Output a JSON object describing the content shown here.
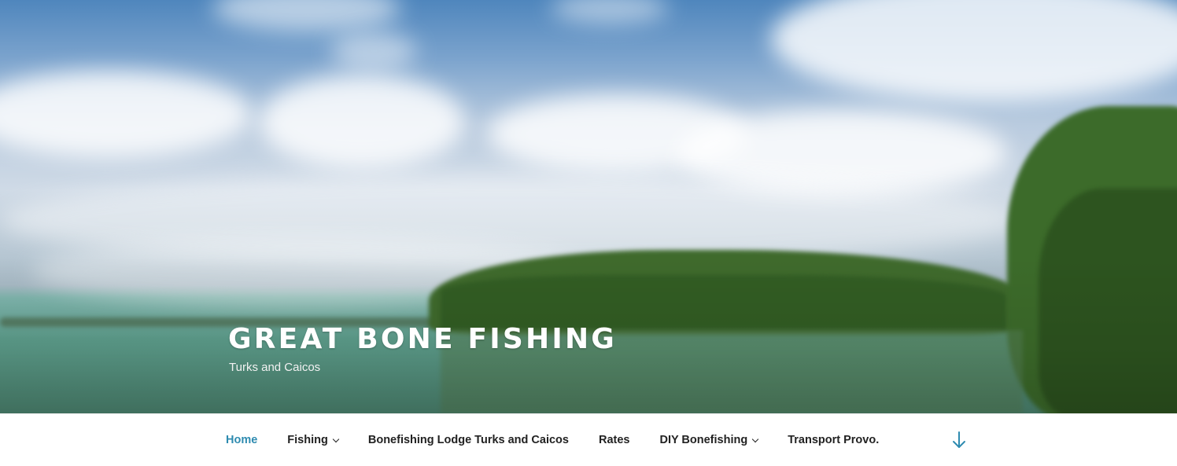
{
  "site": {
    "title": "GREAT BONE FISHING",
    "description": "Turks and Caicos"
  },
  "nav": {
    "items": [
      {
        "label": "Home",
        "current": true,
        "has_submenu": false
      },
      {
        "label": "Fishing",
        "current": false,
        "has_submenu": true
      },
      {
        "label": "Bonefishing Lodge Turks and Caicos",
        "current": false,
        "has_submenu": false
      },
      {
        "label": "Rates",
        "current": false,
        "has_submenu": false
      },
      {
        "label": "DIY Bonefishing",
        "current": false,
        "has_submenu": true
      },
      {
        "label": "Transport Provo.",
        "current": false,
        "has_submenu": false
      }
    ],
    "scroll_icon": "arrow-down-icon"
  },
  "colors": {
    "accent": "#2e8bb0",
    "text": "#222222",
    "title": "#ffffff"
  }
}
